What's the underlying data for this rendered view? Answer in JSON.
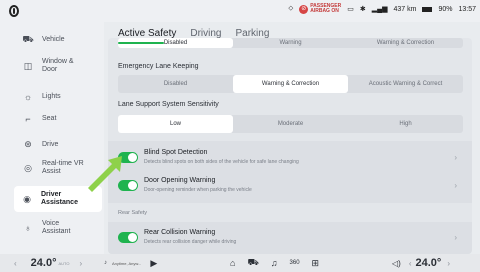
{
  "status": {
    "passenger_airbag_line1": "PASSENGER",
    "passenger_airbag_line2": "AIRBAG ON",
    "range": "437 km",
    "battery": "90%",
    "time": "13:57"
  },
  "sidebar": {
    "items": [
      {
        "label": "Vehicle",
        "icon": "car-icon"
      },
      {
        "label": "Window &\nDoor",
        "icon": "window-icon"
      },
      {
        "label": "Lights",
        "icon": "light-icon"
      },
      {
        "label": "Seat",
        "icon": "seat-icon"
      },
      {
        "label": "Drive",
        "icon": "steering-icon"
      },
      {
        "label": "Real-time VR\nAssist",
        "icon": "vr-icon"
      },
      {
        "label": "Driver\nAssistance",
        "icon": "driver-assist-icon"
      },
      {
        "label": "Voice\nAssistant",
        "icon": "voice-icon"
      }
    ]
  },
  "tabs": [
    {
      "label": "Active Safety"
    },
    {
      "label": "Driving"
    },
    {
      "label": "Parking"
    }
  ],
  "top_seg": [
    "Disabled",
    "Warning",
    "Warning & Correction"
  ],
  "emergency_lane_keeping": {
    "title": "Emergency Lane Keeping",
    "options": [
      "Disabled",
      "Warning & Correction",
      "Acoustic Warning & Correct"
    ],
    "selected": "Warning & Correction"
  },
  "lane_support": {
    "title": "Lane Support System Sensitivity",
    "options": [
      "Low",
      "Moderate",
      "High"
    ],
    "selected": "Low"
  },
  "blind_spot": {
    "title": "Blind Spot Detection",
    "desc": "Detects blind spots on both sides of the vehicle for safe lane changing"
  },
  "door_opening": {
    "title": "Door Opening Warning",
    "desc": "Door-opening reminder when parking the vehicle"
  },
  "rear_safety_label": "Rear Safety",
  "rear_collision": {
    "title": "Rear Collision Warning",
    "desc": "Detects rear collision danger while driving"
  },
  "bottom": {
    "temp_left": "24.0°",
    "temp_right": "24.0°",
    "temp_mode": "AUTO",
    "media_title": "Anytime, Anyw..."
  },
  "colors": {
    "accent": "#1fb34f"
  }
}
